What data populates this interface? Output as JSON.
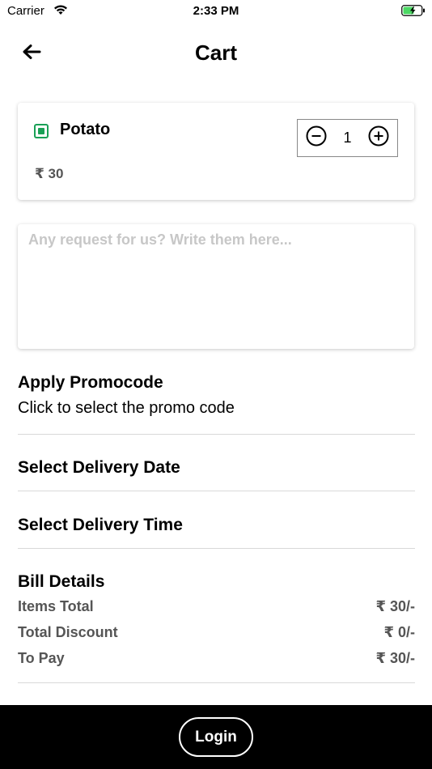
{
  "status_bar": {
    "carrier": "Carrier",
    "time": "2:33 PM",
    "wifi_icon": "wifi-icon",
    "battery_icon": "battery-charging-icon",
    "battery_color": "#4cd964"
  },
  "header": {
    "title": "Cart",
    "back_icon": "arrow-left-icon"
  },
  "cart_item": {
    "name": "Potato",
    "price": "₹ 30",
    "quantity": "1",
    "veg_indicator_color": "#1aa056",
    "veg_icon": "veg-indicator-icon",
    "decrement_icon": "minus-circle-icon",
    "increment_icon": "plus-circle-icon"
  },
  "request": {
    "placeholder": "Any request for us? Write them here...",
    "value": ""
  },
  "promo": {
    "title": "Apply Promocode",
    "subtitle": "Click to select the promo code"
  },
  "delivery_date": {
    "title": "Select Delivery Date"
  },
  "delivery_time": {
    "title": "Select Delivery Time"
  },
  "bill": {
    "title": "Bill Details",
    "rows": [
      {
        "label": "Items Total",
        "value": "₹ 30/-"
      },
      {
        "label": "Total Discount",
        "value": "₹ 0/-"
      },
      {
        "label": "To Pay",
        "value": "₹ 30/-"
      }
    ]
  },
  "footer": {
    "login_label": "Login",
    "background": "#000000"
  }
}
